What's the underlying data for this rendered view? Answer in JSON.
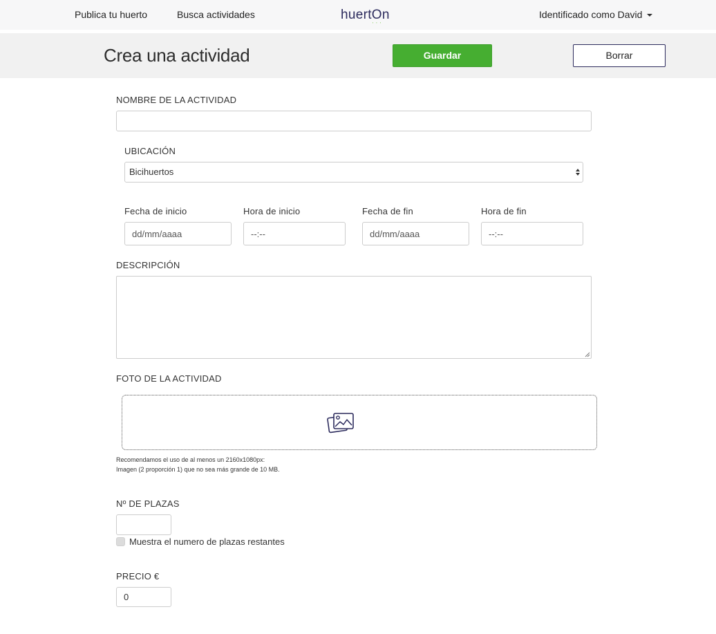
{
  "nav": {
    "publish_label": "Publica tu huerto",
    "search_label": "Busca actividades",
    "logo_text": "huertOn",
    "user_label": "Identificado como David"
  },
  "header": {
    "title": "Crea una actividad",
    "save_label": "Guardar",
    "delete_label": "Borrar"
  },
  "form": {
    "name_label": "NOMBRE DE LA ACTIVIDAD",
    "name_value": "",
    "location_label": "UBICACIÓN",
    "location_value": "Bicihuertos",
    "start_date_label": "Fecha de inicio",
    "start_date_placeholder": "dd/mm/aaaa",
    "start_time_label": "Hora de inicio",
    "start_time_placeholder": "--:--",
    "end_date_label": "Fecha de fin",
    "end_date_placeholder": "dd/mm/aaaa",
    "end_time_label": "Hora de fin",
    "end_time_placeholder": "--:--",
    "description_label": "DESCRIPCIÓN",
    "description_value": "",
    "photo_label": "FOTO DE LA ACTIVIDAD",
    "photo_hint_line1": "Recomendamos el uso de al menos un 2160x1080px:",
    "photo_hint_line2": "Imagen (2 proporción 1) que no sea más grande de 10 MB.",
    "spots_label": "Nº DE PLAZAS",
    "spots_value": "",
    "show_spots_label": "Muestra el numero de plazas restantes",
    "show_spots_checked": false,
    "price_label": "PRECIO €",
    "price_value": "0"
  },
  "colors": {
    "save_button": "#46ae31",
    "brand": "#2b2a5c",
    "logo_sprout": "#7cc84b"
  },
  "icons": {
    "user_menu": "chevron-down-icon",
    "dropzone": "image-gallery-icon",
    "select": "select-arrows-icon"
  }
}
